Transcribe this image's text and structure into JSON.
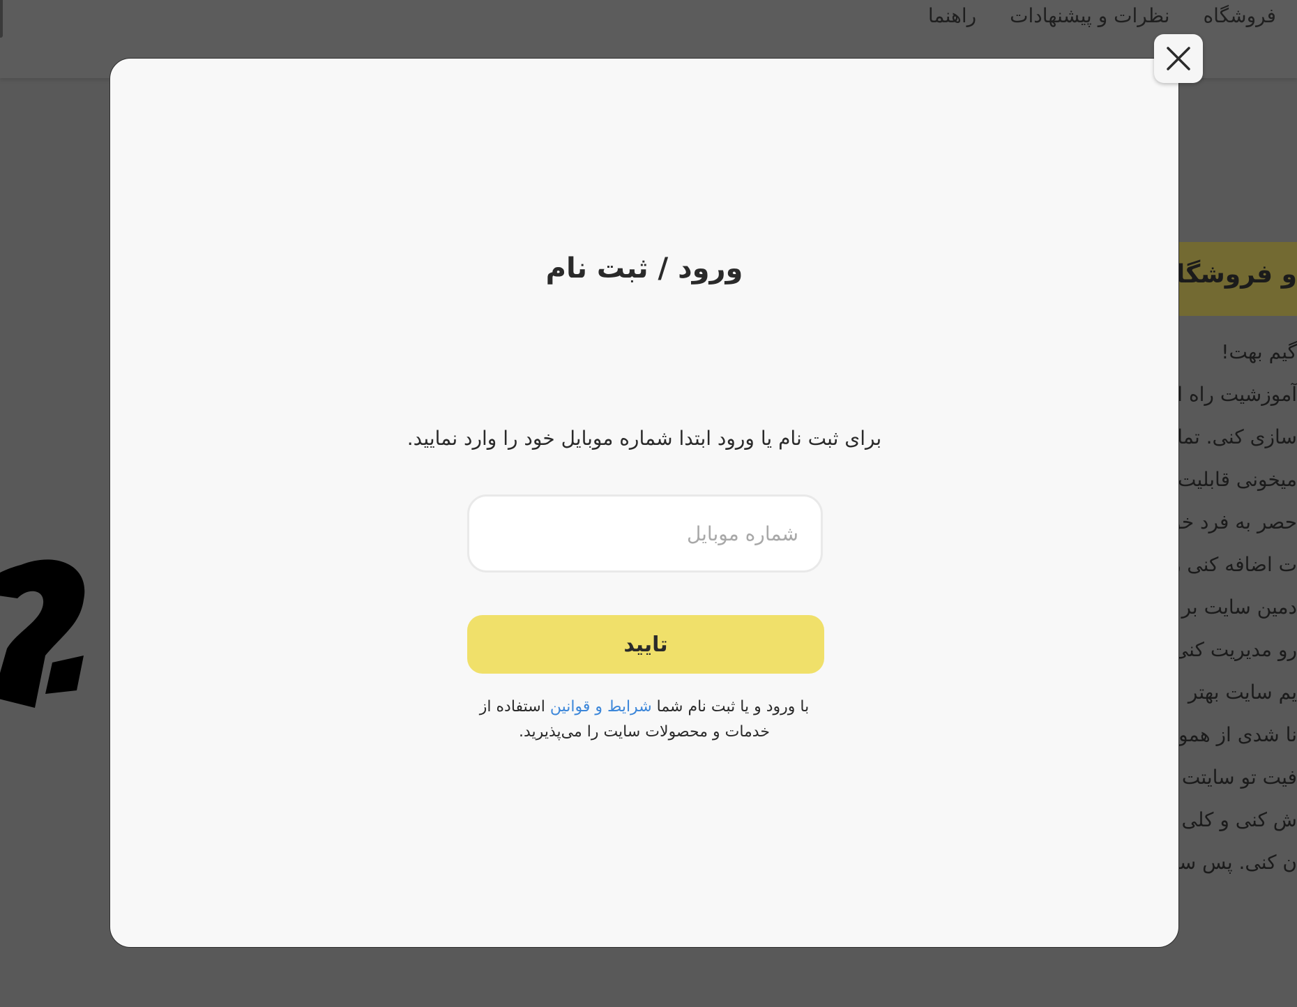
{
  "nav": {
    "items": [
      "فروشگاه",
      "نظرات و پیشنهادات",
      "راهنما"
    ]
  },
  "background": {
    "banner": "و فروشگاه دو",
    "lines": [
      "گیم بهت!",
      "آموزشیت راه ان",
      "سازی کنی. تما",
      "میخونی قابلیت",
      "حصر به فرد خو",
      "ت اضافه کنی رو",
      "دمین سایت بر",
      "رو مدیریت کنی",
      "یم سایت بهتر",
      "نا شدی از همو",
      "فیت تو سایتت",
      "ش کنی و کلی",
      "ن کنی. پس سر"
    ]
  },
  "modal": {
    "close_icon": "close-icon",
    "title": "ورود / ثبت نام",
    "description": "برای ثبت نام یا ورود ابتدا شماره موبایل خود را وارد نمایید.",
    "phone_input": {
      "value": "",
      "placeholder": "شماره موبایل"
    },
    "confirm_label": "تایید",
    "terms": {
      "before": "با ورود و یا ثبت نام شما ",
      "link": "شرایط و قوانین",
      "after": " استفاده از خدمات و محصولات سایت را می‌پذیرید."
    }
  },
  "colors": {
    "overlay": "#595959",
    "modal_bg": "#f8f8f8",
    "confirm": "#f0e06a",
    "link": "#3b86d9"
  }
}
